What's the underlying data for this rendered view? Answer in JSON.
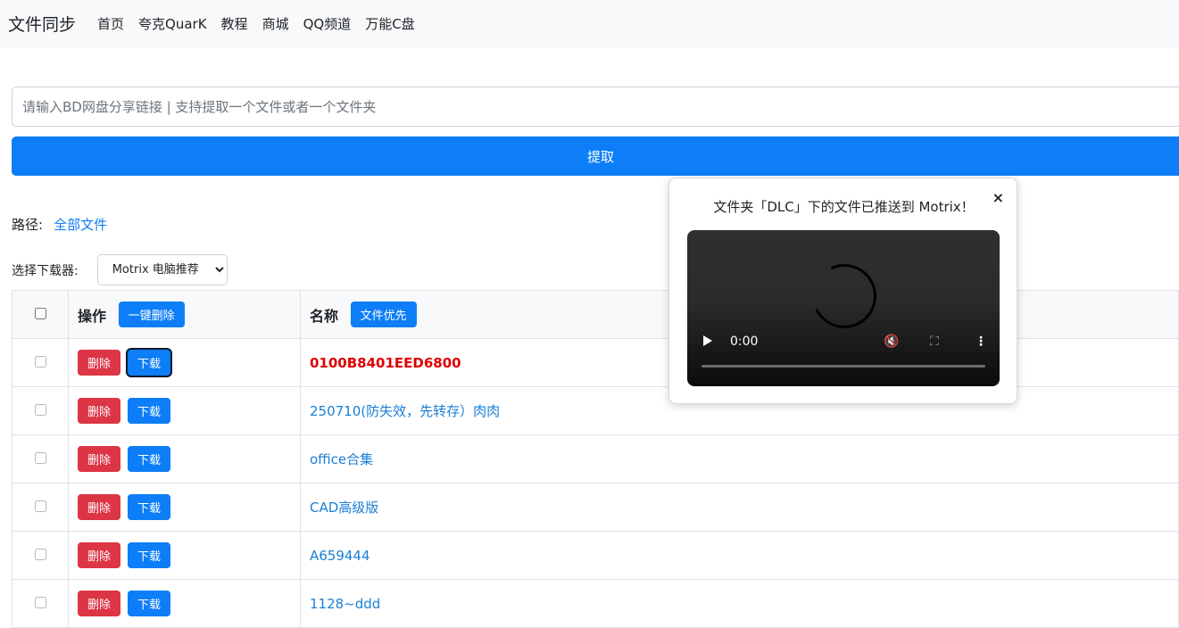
{
  "navbar": {
    "brand": "文件同步",
    "links": [
      "首页",
      "夸克QuarK",
      "教程",
      "商城",
      "QQ频道",
      "万能C盘"
    ]
  },
  "search": {
    "placeholder": "请输入BD网盘分享链接 | 支持提取一个文件或者一个文件夹",
    "value": ""
  },
  "extract_button": "提取",
  "path": {
    "label": "路径:",
    "link": "全部文件"
  },
  "downloader": {
    "label": "选择下载器:",
    "selected": "Motrix 电脑推荐"
  },
  "table": {
    "header": {
      "operation": "操作",
      "bulk_delete": "一键删除",
      "name": "名称",
      "folder_first": "文件优先"
    },
    "delete_label": "删除",
    "download_label": "下载",
    "rows": [
      {
        "name": "0100B8401EED6800",
        "highlight": true
      },
      {
        "name": "250710(防失效，先转存）肉肉",
        "highlight": false
      },
      {
        "name": "office合集",
        "highlight": false
      },
      {
        "name": "CAD高级版",
        "highlight": false
      },
      {
        "name": "A659444",
        "highlight": false
      },
      {
        "name": "1128~ddd",
        "highlight": false
      }
    ]
  },
  "popup": {
    "message": "文件夹「DLC」下的文件已推送到 Motrix！",
    "close": "×",
    "video": {
      "time": "0:00",
      "progress": 0
    }
  },
  "colors": {
    "primary": "#0d7ef7",
    "danger": "#dc3545",
    "link": "#1a7fd6",
    "highlight": "#e00000"
  }
}
